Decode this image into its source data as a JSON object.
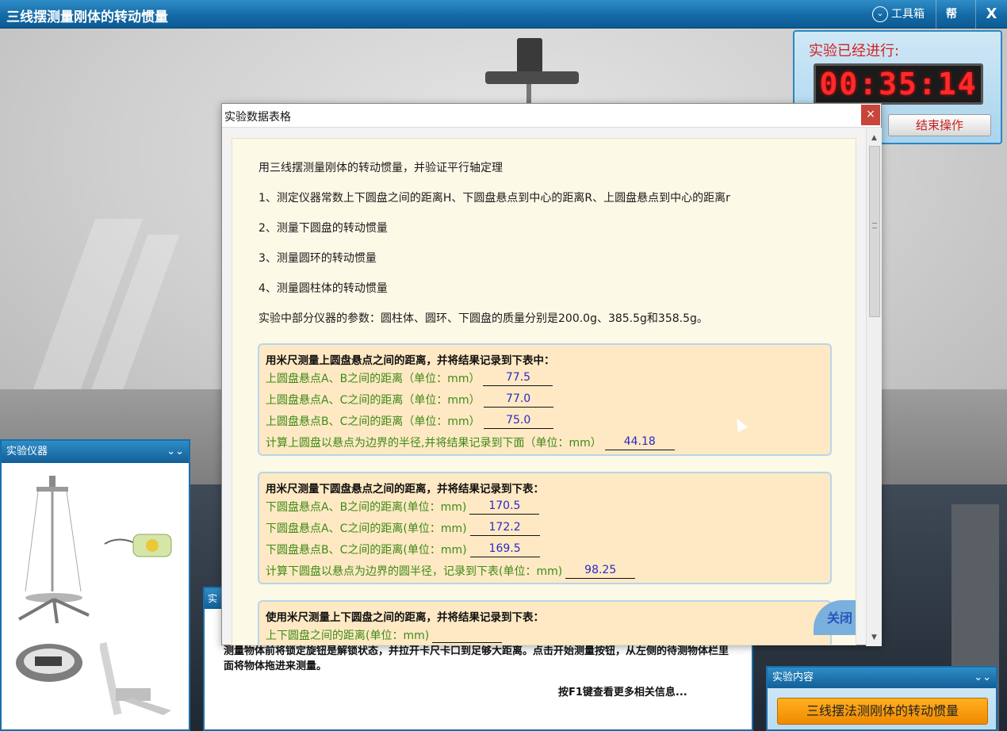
{
  "window": {
    "title": "三线摆测量刚体的转动惯量",
    "toolbox_label": "工具箱",
    "help_label": "帮助",
    "close_label": "X"
  },
  "timer": {
    "label": "实验已经进行:",
    "time": "00:35:14",
    "end_button": "结束操作"
  },
  "instruments_panel": {
    "title": "实验仪器",
    "collapse_icon": "double-chevron-down-icon"
  },
  "info_panel": {
    "tab_label": "实",
    "text": "测量物体前将锁定旋钮是解锁状态，并拉开卡尺卡口到足够大距离。点击开始测量按钮，从左侧的待测物体栏里面将物体拖进来测量。",
    "hint": "按F1键查看更多相关信息..."
  },
  "content_panel": {
    "title": "实验内容",
    "button": "三线摆法测刚体的转动惯量"
  },
  "dialog": {
    "title": "实验数据表格",
    "intro": "用三线摆测量刚体的转动惯量，并验证平行轴定理",
    "steps": [
      "1、测定仪器常数上下圆盘之间的距离H、下圆盘悬点到中心的距离R、上圆盘悬点到中心的距离r",
      "2、测量下圆盘的转动惯量",
      "3、测量圆环的转动惯量",
      "4、测量圆柱体的转动惯量"
    ],
    "params": "实验中部分仪器的参数：圆柱体、圆环、下圆盘的质量分别是200.0g、385.5g和358.5g。",
    "section1": {
      "title": "用米尺测量上圆盘悬点之间的距离，并将结果记录到下表中：",
      "rows": [
        {
          "label": "上圆盘悬点A、B之间的距离（单位：mm）",
          "value": "77.5"
        },
        {
          "label": "上圆盘悬点A、C之间的距离（单位：mm）",
          "value": "77.0"
        },
        {
          "label": "上圆盘悬点B、C之间的距离（单位：mm）",
          "value": "75.0"
        },
        {
          "label": "计算上圆盘以悬点为边界的半径,并将结果记录到下面（单位：mm）",
          "value": "44.18"
        }
      ]
    },
    "section2": {
      "title": "用米尺测量下圆盘悬点之间的距离，并将结果记录到下表：",
      "rows": [
        {
          "label": "下圆盘悬点A、B之间的距离(单位：mm)",
          "value": "170.5"
        },
        {
          "label": "下圆盘悬点A、C之间的距离(单位：mm)",
          "value": "172.2"
        },
        {
          "label": "下圆盘悬点B、C之间的距离(单位：mm)",
          "value": "169.5"
        },
        {
          "label": "计算下圆盘以悬点为边界的圆半径，记录到下表(单位：mm)",
          "value": "98.25"
        }
      ]
    },
    "section3": {
      "title": "使用米尺测量上下圆盘之间的距离，并将结果记录到下表：",
      "rows": [
        {
          "label": "上下圆盘之间的距离(单位：mm)",
          "value": ""
        }
      ]
    },
    "close_badge": "关闭"
  }
}
